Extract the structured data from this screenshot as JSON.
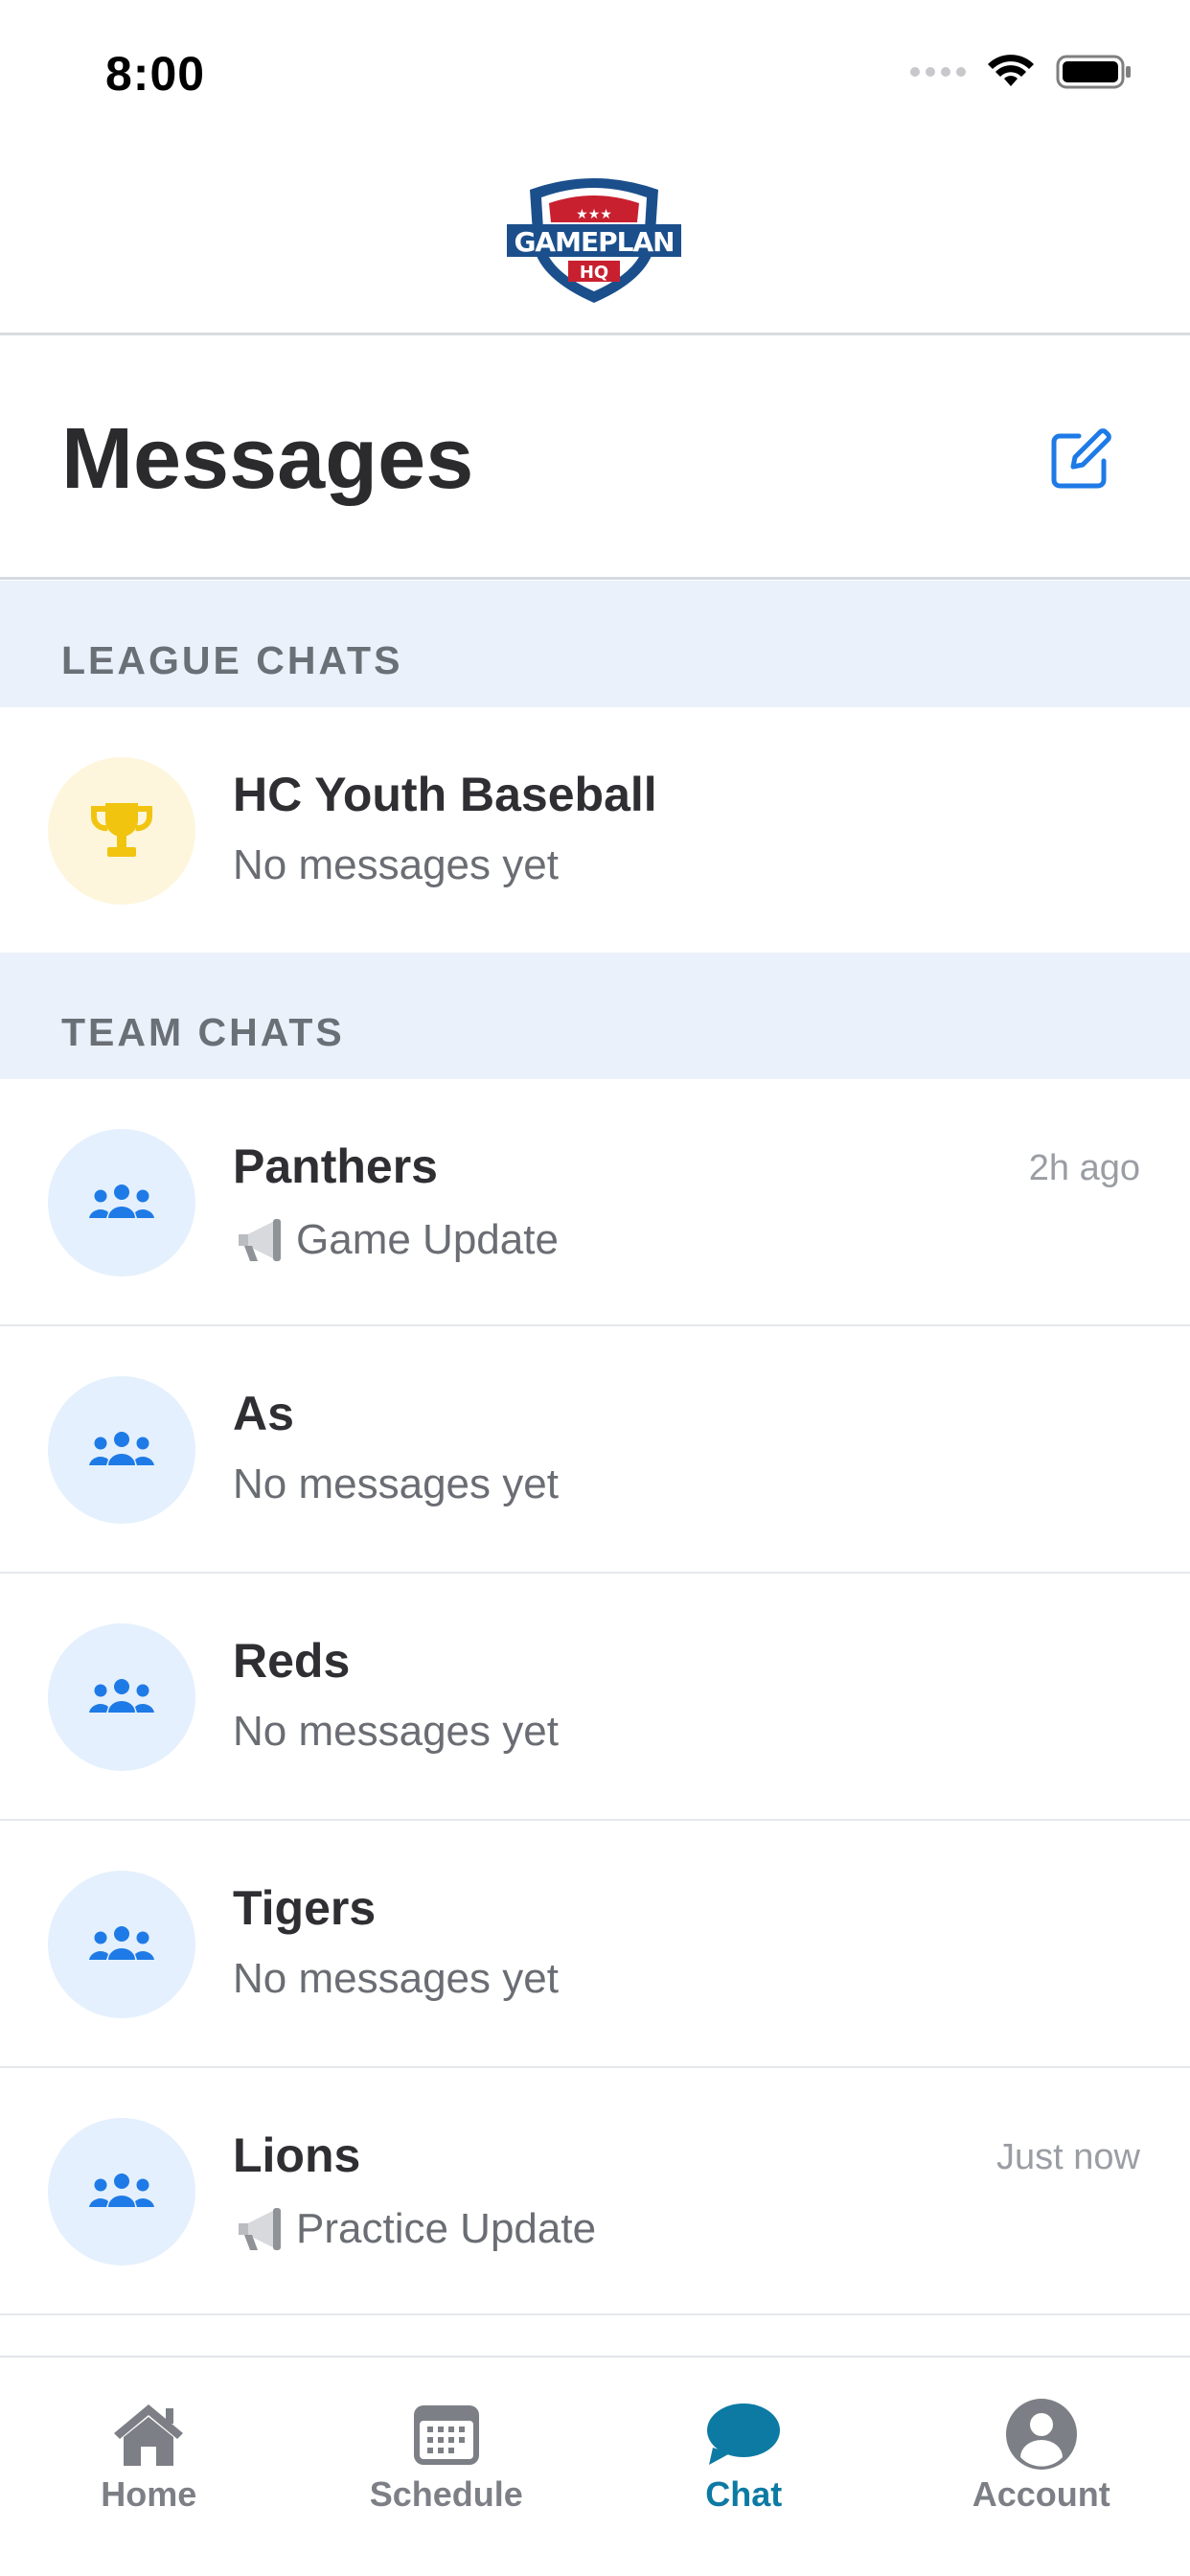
{
  "status_bar": {
    "time": "8:00"
  },
  "page": {
    "title": "Messages"
  },
  "league_section": {
    "header": "LEAGUE CHATS",
    "items": [
      {
        "name": "HC Youth Baseball",
        "preview": "No messages yet"
      }
    ]
  },
  "team_section": {
    "header": "TEAM CHATS",
    "items": [
      {
        "name": "Panthers",
        "preview": "Game Update",
        "time": "2h ago"
      },
      {
        "name": "As",
        "preview": "No messages yet"
      },
      {
        "name": "Reds",
        "preview": "No messages yet"
      },
      {
        "name": "Tigers",
        "preview": "No messages yet"
      },
      {
        "name": "Lions",
        "preview": "Practice Update",
        "time": "Just now"
      }
    ]
  },
  "tabs": [
    {
      "label": "Home",
      "icon": "home-icon"
    },
    {
      "label": "Schedule",
      "icon": "calendar-icon"
    },
    {
      "label": "Chat",
      "icon": "chat-bubble-icon",
      "active": true
    },
    {
      "label": "Account",
      "icon": "account-icon"
    }
  ],
  "colors": {
    "accent_blue": "#1e7ae6",
    "tab_active": "#0d7aa3",
    "section_bg": "#eaf1fb",
    "trophy": "#f1c40f"
  }
}
